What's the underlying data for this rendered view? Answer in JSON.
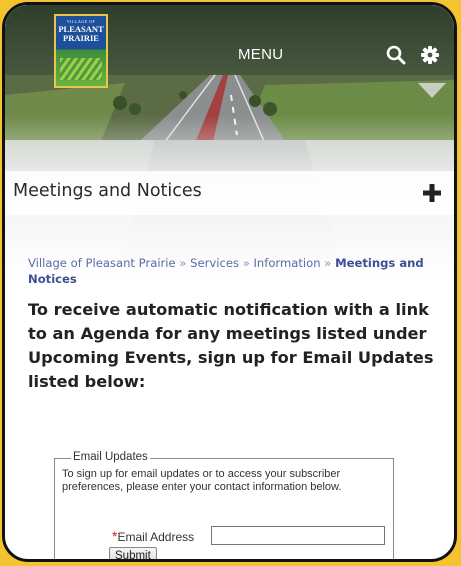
{
  "header": {
    "logo": {
      "small_text": "VILLAGE OF",
      "name_line1": "PLEASANT",
      "name_line2": "PRAIRIE"
    },
    "menu_label": "MENU",
    "icons": [
      "search-icon",
      "gear-icon",
      "triangle-down-icon"
    ]
  },
  "page_title": "Meetings and Notices",
  "expand_icon": "plus-icon",
  "breadcrumb": {
    "items": [
      "Village of Pleasant Prairie",
      "Services",
      "Information"
    ],
    "separator": "»",
    "current": "Meetings and Notices"
  },
  "intro_text": "To receive automatic notification with a link to an Agenda for any meetings listed under Upcoming Events, sign up for Email Updates listed below:",
  "email_updates": {
    "legend": "Email Updates",
    "description": "To sign up for email updates or to access your subscriber preferences, please enter your contact information below.",
    "required_marker": "*",
    "email_label": "Email Address",
    "email_value": "",
    "submit_label": "Submit"
  },
  "colors": {
    "border_yellow": "#f4c430",
    "frame_black": "#111111",
    "link_blue": "#5a6ca8",
    "required_red": "#cc2222"
  }
}
